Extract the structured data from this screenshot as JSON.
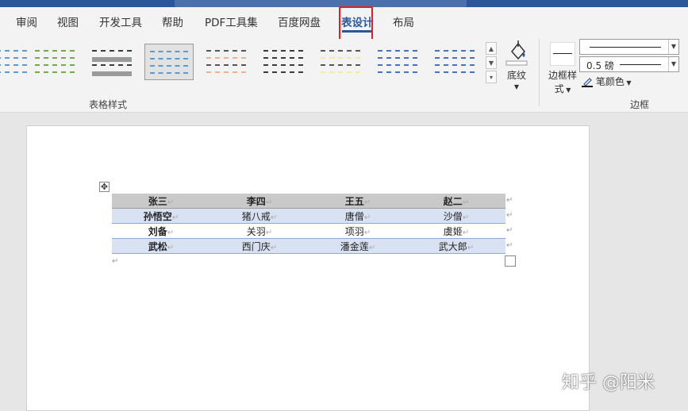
{
  "tabs": [
    "审阅",
    "视图",
    "开发工具",
    "帮助",
    "PDF工具集",
    "百度网盘",
    "表设计",
    "布局"
  ],
  "active_tab": "表设计",
  "ribbon": {
    "table_styles_label": "表格样式",
    "shading_label": "底纹",
    "border_styles_label_line1": "边框样",
    "border_styles_label_line2": "式",
    "pen_weight": "0.5 磅",
    "pen_color_label": "笔颜色",
    "borders_group_label": "边框",
    "style_colors": [
      "#5b9bd5",
      "#3a3a3a",
      "#70ad47",
      "#555555",
      "#4472c4",
      "#ed7d31",
      "#555555",
      "#ffc000",
      "#4472c4",
      "#70ad47"
    ]
  },
  "table": {
    "rows": [
      [
        "张三",
        "李四",
        "王五",
        "赵二"
      ],
      [
        "孙悟空",
        "猪八戒",
        "唐僧",
        "沙僧"
      ],
      [
        "刘备",
        "关羽",
        "项羽",
        "虞姬"
      ],
      [
        "武松",
        "西门庆",
        "潘金莲",
        "武大郎"
      ]
    ]
  },
  "watermark": "知乎 @阳米",
  "colors": {
    "accent": "#2b579a",
    "highlight": "#e02020",
    "header_fill": "#c9c9c9",
    "band_fill": "#d9e2f3"
  }
}
